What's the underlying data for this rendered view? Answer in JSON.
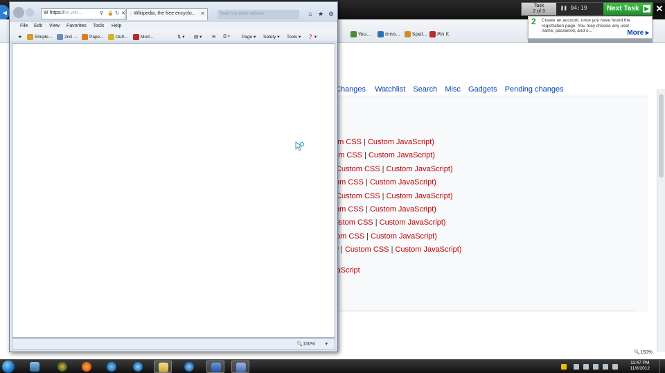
{
  "background_browser": {
    "nav_links": [
      "Changes",
      "Watchlist",
      "Search",
      "Misc",
      "Gadgets",
      "Pending changes"
    ],
    "skin_rows": [
      {
        "prefix": "om CSS",
        "css": "",
        "js": "Custom JavaScript)"
      },
      {
        "prefix": "om CSS",
        "css": "",
        "js": "Custom JavaScript)"
      },
      {
        "prefix": "",
        "css": "Custom CSS",
        "js": "Custom JavaScript)"
      },
      {
        "prefix": "om CSS",
        "css": "",
        "js": "Custom JavaScript)"
      },
      {
        "prefix": "Custom CSS",
        "css": "",
        "js": "Custom JavaScript)"
      },
      {
        "prefix": "om CSS",
        "css": "",
        "js": "Custom JavaScript)"
      },
      {
        "prefix": "ustom CSS",
        "css": "",
        "js": "Custom JavaScript)"
      },
      {
        "prefix": "tom CSS",
        "css": "",
        "js": "Custom JavaScript)"
      },
      {
        "prefix": "w",
        "css": "Custom CSS",
        "js": "Custom JavaScript)"
      }
    ],
    "trailing_link": "vaScript",
    "favorites": [
      "Simple...",
      "2nd ...",
      "Pape...",
      "Outl...",
      "Mort...",
      "You...",
      "Inno...",
      "Spel...",
      "Pin it"
    ],
    "zoom": "150%",
    "close_glyph": "✕"
  },
  "task_widget": {
    "task_label_line1": "Task",
    "task_label_line2": "2 of 3",
    "timer": "04:19",
    "next_task_label": "Next Task",
    "step_number": "2",
    "instruction": "Create an account. once you have found the registration page. You may choose any user name, password, and o...",
    "more_label": "More ▸"
  },
  "ie_window": {
    "address_prefix": "https://",
    "address_rest": "en.wik...",
    "tab_title": "Wikipedia, the free encyclo...",
    "tab_close": "✕",
    "search_placeholder": "Search or enter address",
    "menu_items": [
      "File",
      "Edit",
      "View",
      "Favorites",
      "Tools",
      "Help"
    ],
    "favorites": [
      "Simple...",
      "2nd ...",
      "Pape...",
      "Outl...",
      "Mort..."
    ],
    "command_items": [
      "Page ▾",
      "Safety ▾",
      "Tools ▾"
    ],
    "zoom": "150%",
    "zoom_arrow": "▾",
    "controls": {
      "home": "⌂",
      "star": "★",
      "gear": "⚙"
    }
  },
  "taskbar": {
    "clock_time": "11:47 PM",
    "clock_date": "11/8/2012"
  }
}
